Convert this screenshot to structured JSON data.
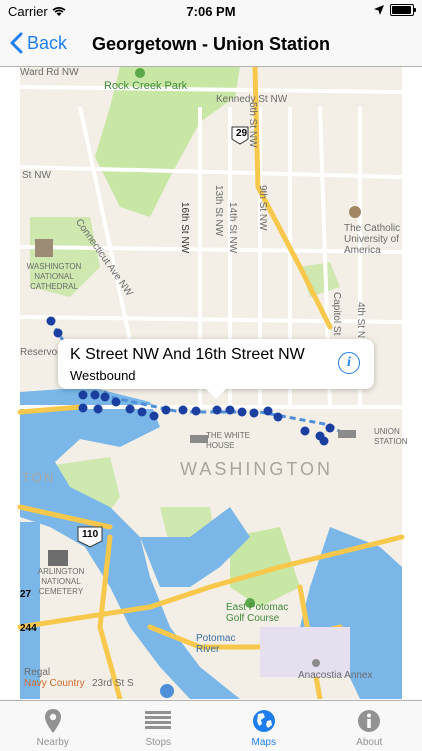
{
  "status_bar": {
    "carrier": "Carrier",
    "time": "7:06 PM"
  },
  "nav": {
    "back_label": "Back",
    "title": "Georgetown - Union Station"
  },
  "map": {
    "labels": {
      "rock_creek_park": "Rock Creek Park",
      "kennedy_st": "Kennedy St NW",
      "ward_rd": "Ward Rd NW",
      "route_29": "29",
      "st_nw_left": "St NW",
      "connecticut_ave": "Connecticut Ave NW",
      "16th_st": "16th St NW",
      "14th_st": "14th St NW",
      "13th_st": "13th St NW",
      "5th_st": "5th St NW",
      "9th_st": "9th St NW",
      "catholic_univ": "The Catholic University of America",
      "national_cathedral": "WASHINGTON NATIONAL CATHEDRAL",
      "capitol_st": "Capitol St NE",
      "4th_st_ne": "4th St NE",
      "reservoir": "Reservoir Rd",
      "white_house": "THE WHITE HOUSE",
      "union_station": "UNION STATION",
      "washington": "WASHINGTON",
      "ton": "TON",
      "route_110": "110",
      "arlington_cemetery": "ARLINGTON NATIONAL CEMETERY",
      "route_27": "27",
      "route_244": "244",
      "east_potomac": "East Potomac Golf Course",
      "potomac_river": "Potomac River",
      "anacostia_annex": "Anacostia Annex",
      "regal": "Regal",
      "navy_country": "Navy Country",
      "23rd_st": "23rd St S"
    },
    "callout": {
      "title": "K Street NW And 16th Street NW",
      "subtitle": "Westbound"
    },
    "colors": {
      "route_dot": "#1b3fa0",
      "route_line": "#4f8fd8",
      "water": "#7ab7e8",
      "park": "#c8e6a4",
      "highway": "#f7c84c"
    }
  },
  "tabs": [
    {
      "label": "Nearby",
      "icon": "location-pin-icon",
      "active": false
    },
    {
      "label": "Stops",
      "icon": "list-icon",
      "active": false
    },
    {
      "label": "Maps",
      "icon": "globe-icon",
      "active": true
    },
    {
      "label": "About",
      "icon": "info-icon",
      "active": false
    }
  ]
}
